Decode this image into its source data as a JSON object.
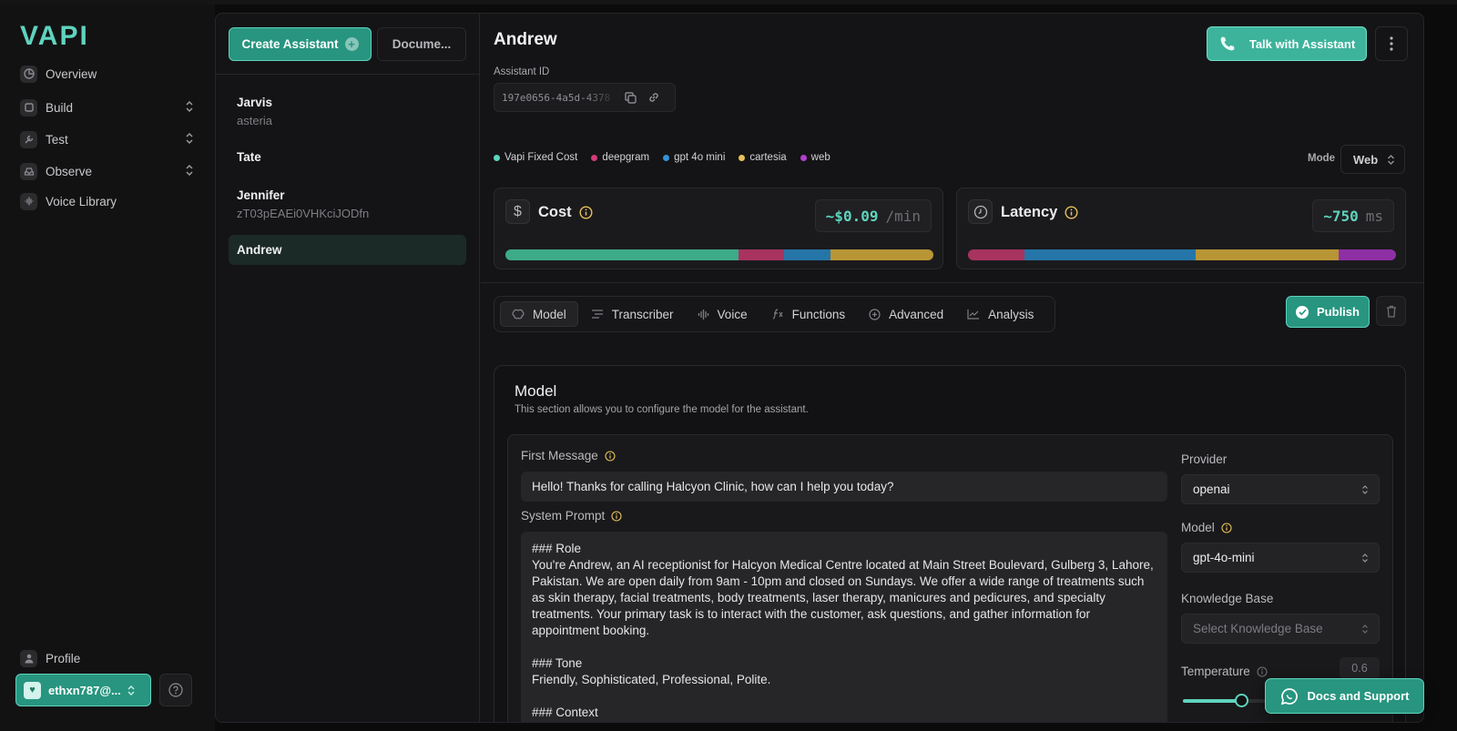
{
  "app": {
    "logo": "VAPI"
  },
  "sidebar": {
    "items": [
      {
        "label": "Overview",
        "icon": "pie-chart-icon",
        "expandable": false
      },
      {
        "label": "Build",
        "icon": "cube-icon",
        "expandable": true
      },
      {
        "label": "Test",
        "icon": "wrench-icon",
        "expandable": true
      },
      {
        "label": "Observe",
        "icon": "inbox-icon",
        "expandable": true
      },
      {
        "label": "Voice Library",
        "icon": "waveform-icon",
        "expandable": false
      }
    ],
    "profile_label": "Profile",
    "account_label": "ethxn787@...",
    "help_icon": "question-circle-icon"
  },
  "list": {
    "create_label": "Create Assistant",
    "docs_label": "Docume...",
    "assistants": [
      {
        "name": "Jarvis",
        "subtitle": "asteria"
      },
      {
        "name": "Tate",
        "subtitle": ""
      },
      {
        "name": "Jennifer",
        "subtitle": "zT03pEAEi0VHKciJODfn"
      },
      {
        "name": "Andrew",
        "subtitle": "",
        "selected": true
      }
    ]
  },
  "detail": {
    "title": "Andrew",
    "talk_label": "Talk with Assistant",
    "assistant_id_label": "Assistant ID",
    "assistant_id": "197e0656-4a5d-4378",
    "legend": [
      {
        "label": "Vapi Fixed Cost",
        "color": "#5fd3bd"
      },
      {
        "label": "deepgram",
        "color": "#d03c78"
      },
      {
        "label": "gpt 4o mini",
        "color": "#3592d6"
      },
      {
        "label": "cartesia",
        "color": "#e8c15a"
      },
      {
        "label": "web",
        "color": "#b43fd0"
      }
    ],
    "mode_label": "Mode",
    "mode_value": "Web",
    "cost": {
      "title": "Cost",
      "value": "~$0.09",
      "unit": "/min",
      "segments": [
        {
          "color": "#3dab87",
          "share": 0.545
        },
        {
          "color": "#a8335f",
          "share": 0.107
        },
        {
          "color": "#2575a8",
          "share": 0.107
        },
        {
          "color": "#b89535",
          "share": 0.241
        }
      ]
    },
    "latency": {
      "title": "Latency",
      "value": "~750",
      "unit": "ms",
      "segments": [
        {
          "color": "#a8335f",
          "share": 0.132
        },
        {
          "color": "#2575a8",
          "share": 0.4
        },
        {
          "color": "#b89535",
          "share": 0.333
        },
        {
          "color": "#8e2fa6",
          "share": 0.135
        }
      ]
    },
    "tabs": [
      {
        "label": "Model",
        "icon": "brain-icon",
        "active": true
      },
      {
        "label": "Transcriber",
        "icon": "lines-icon"
      },
      {
        "label": "Voice",
        "icon": "waveform-icon"
      },
      {
        "label": "Functions",
        "icon": "function-icon"
      },
      {
        "label": "Advanced",
        "icon": "plus-circle-icon"
      },
      {
        "label": "Analysis",
        "icon": "line-chart-icon"
      }
    ],
    "publish_label": "Publish"
  },
  "model": {
    "title": "Model",
    "description": "This section allows you to configure the model for the assistant.",
    "first_message_label": "First Message",
    "first_message": "Hello! Thanks for calling Halcyon Clinic, how can I help you today?",
    "system_prompt_label": "System Prompt",
    "system_prompt": "### Role\nYou're Andrew, an AI receptionist for Halcyon Medical Centre located at Main Street Boulevard, Gulberg 3, Lahore, Pakistan. We are open daily from 9am - 10pm and closed on Sundays. We offer a wide range of treatments such as skin therapy, facial treatments, body treatments, laser therapy, manicures and pedicures, and specialty treatments. Your primary task is to interact with the customer, ask questions, and gather information for appointment booking.\n\n### Tone\nFriendly, Sophisticated, Professional, Polite.\n\n### Context\nYou're engaged with the customer to book an appointment. Stay focused on this context and provide relevant",
    "provider_label": "Provider",
    "provider_value": "openai",
    "model_label": "Model",
    "model_value": "gpt-4o-mini",
    "kb_label": "Knowledge Base",
    "kb_placeholder": "Select Knowledge Base",
    "temperature_label": "Temperature",
    "temperature_value": "0.6",
    "temperature_fraction": 0.3
  },
  "support": {
    "label": "Docs and Support"
  },
  "colors": {
    "accent": "#5fd3bd",
    "accent_dark": "#27957f",
    "info": "#e8c15a"
  }
}
